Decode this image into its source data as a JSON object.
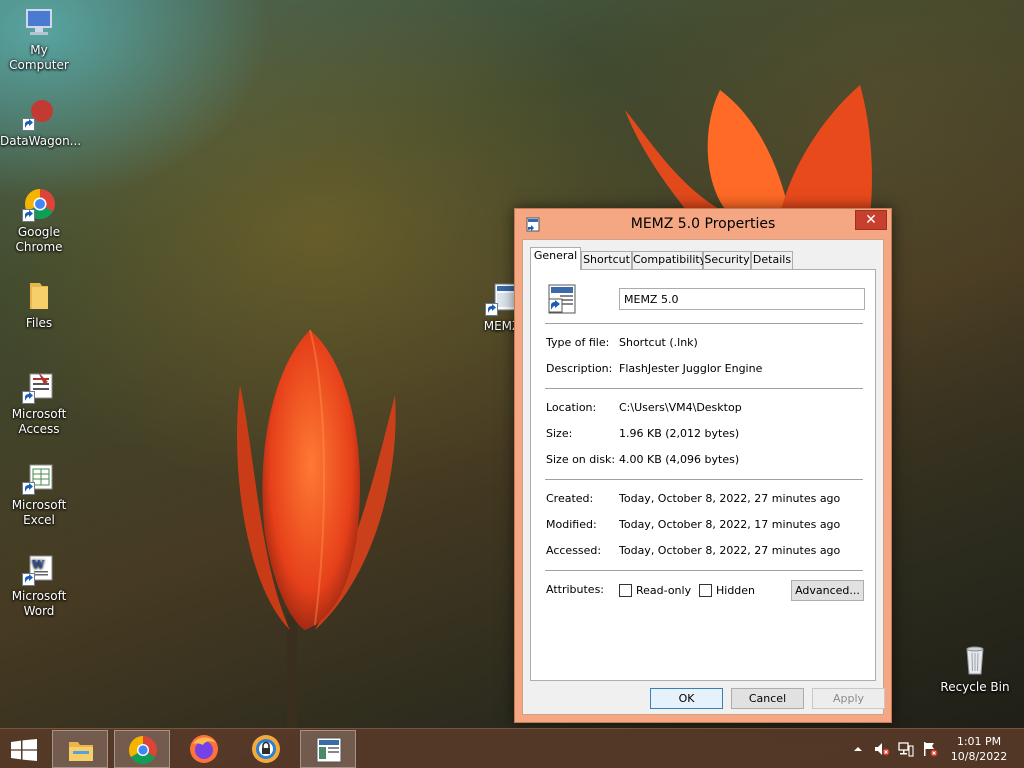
{
  "desktop": {
    "icons": [
      {
        "label": "My Computer",
        "icon": "computer-icon"
      },
      {
        "label": "DataWagon...",
        "icon": "datawagon-shortcut-icon"
      },
      {
        "label": "Google Chrome",
        "icon": "chrome-icon"
      },
      {
        "label": "Files",
        "icon": "folder-icon"
      },
      {
        "label": "Microsoft Access",
        "icon": "access-icon"
      },
      {
        "label": "Microsoft Excel",
        "icon": "excel-icon"
      },
      {
        "label": "Microsoft Word",
        "icon": "word-icon"
      },
      {
        "label": "MEMZ",
        "icon": "memz-shortcut-icon"
      },
      {
        "label": "Recycle Bin",
        "icon": "recycle-bin-icon"
      }
    ]
  },
  "dialog": {
    "title": "MEMZ 5.0 Properties",
    "close_label": "✕",
    "tabs": [
      "General",
      "Shortcut",
      "Compatibility",
      "Security",
      "Details"
    ],
    "active_tab": "General",
    "file_name": "MEMZ 5.0",
    "rows": {
      "type_label": "Type of file:",
      "type_value": "Shortcut (.lnk)",
      "desc_label": "Description:",
      "desc_value": "FlashJester Jugglor Engine",
      "location_label": "Location:",
      "location_value": "C:\\Users\\VM4\\Desktop",
      "size_label": "Size:",
      "size_value": "1.96 KB (2,012 bytes)",
      "size_disk_label": "Size on disk:",
      "size_disk_value": "4.00 KB (4,096 bytes)",
      "created_label": "Created:",
      "created_value": "Today, October 8, 2022, 27 minutes ago",
      "modified_label": "Modified:",
      "modified_value": "Today, October 8, 2022, 17 minutes ago",
      "accessed_label": "Accessed:",
      "accessed_value": "Today, October 8, 2022, 27 minutes ago"
    },
    "attributes": {
      "label": "Attributes:",
      "readonly_label": "Read-only",
      "readonly_checked": false,
      "hidden_label": "Hidden",
      "hidden_checked": false,
      "advanced_label": "Advanced..."
    },
    "buttons": {
      "ok": "OK",
      "cancel": "Cancel",
      "apply": "Apply"
    }
  },
  "taskbar": {
    "apps": [
      "start-icon",
      "file-explorer-icon",
      "chrome-icon",
      "firefox-icon",
      "password-manager-icon",
      "memz-icon"
    ],
    "clock": {
      "time": "1:01 PM",
      "date": "10/8/2022"
    }
  },
  "colors": {
    "dialog_frame": "#f4a782",
    "close_button": "#c7402d",
    "taskbar": "#583a28"
  }
}
